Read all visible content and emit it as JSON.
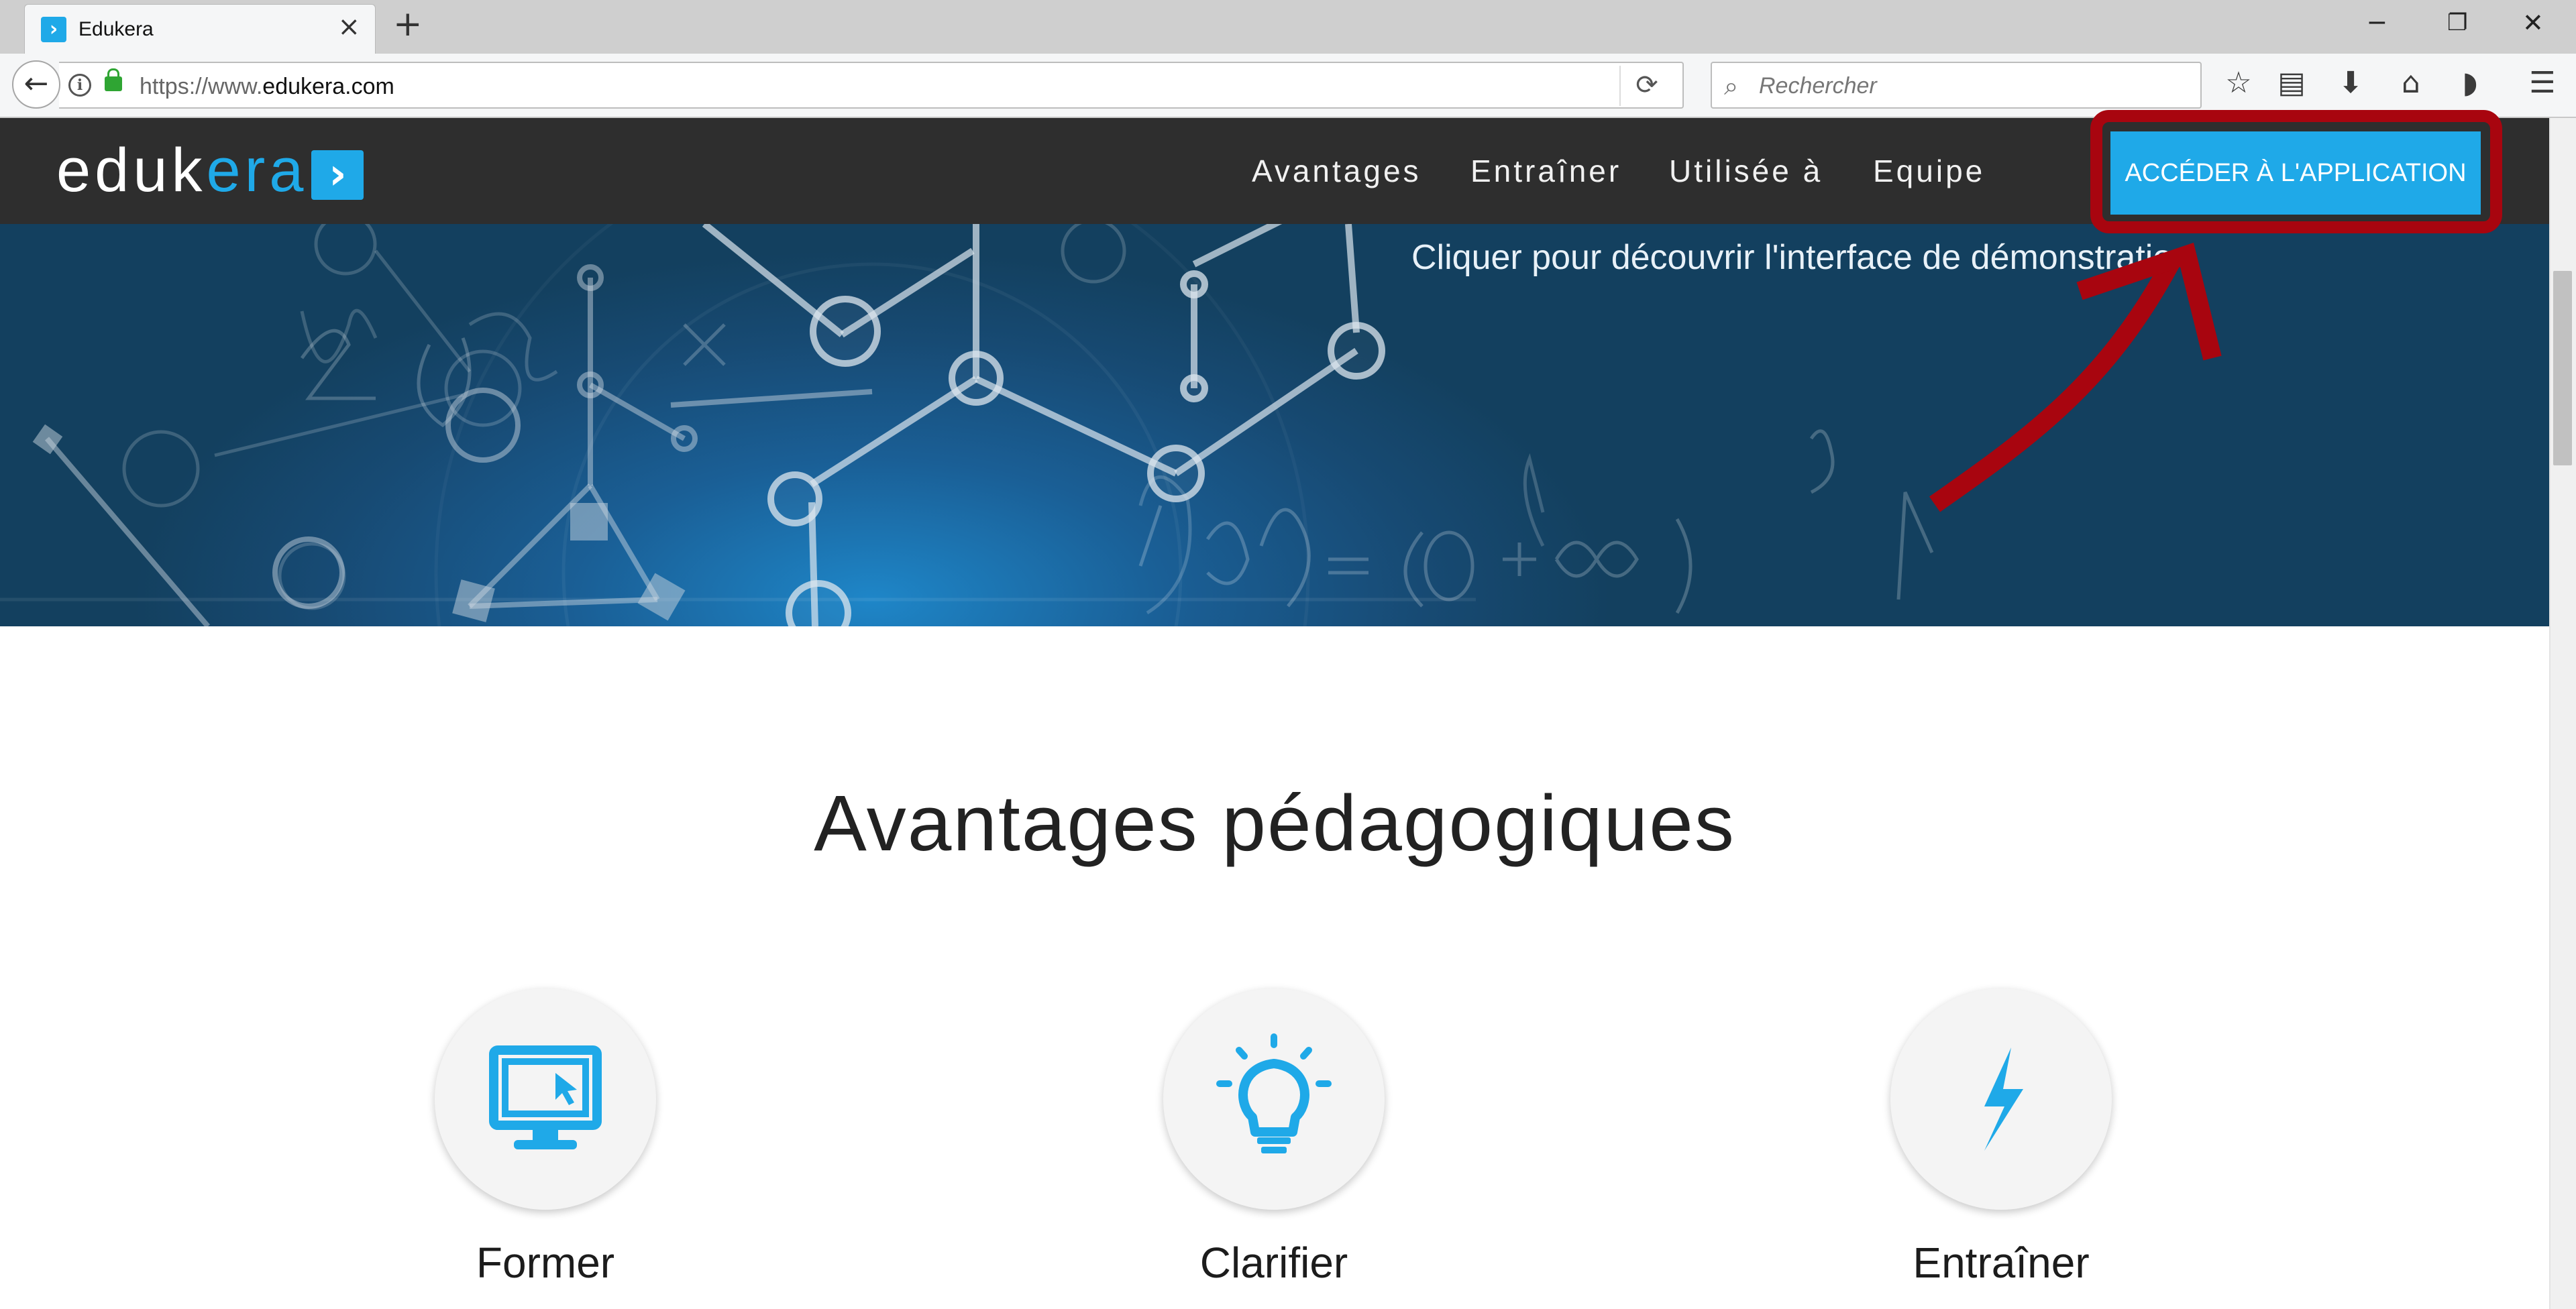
{
  "browser": {
    "tab_title": "Edukera",
    "url_prefix": "https://www.",
    "url_domain": "edukera.com",
    "search_placeholder": "Rechercher"
  },
  "site": {
    "logo_part1": "eduk",
    "logo_part2": "era",
    "nav": [
      "Avantages",
      "Entraîner",
      "Utilisée à",
      "Equipe"
    ],
    "cta_label": "ACCÉDER À L'APPLICATION",
    "hero_caption": "Cliquer pour découvrir l'interface de démonstration",
    "section_title": "Avantages pédagogiques",
    "features": [
      {
        "label": "Former",
        "icon": "monitor-icon"
      },
      {
        "label": "Clarifier",
        "icon": "lightbulb-icon"
      },
      {
        "label": "Entraîner",
        "icon": "lightning-icon"
      }
    ]
  },
  "colors": {
    "accent": "#1fa9e8",
    "header_bg": "#2e2e2e",
    "annotation_red": "#a8050f"
  }
}
